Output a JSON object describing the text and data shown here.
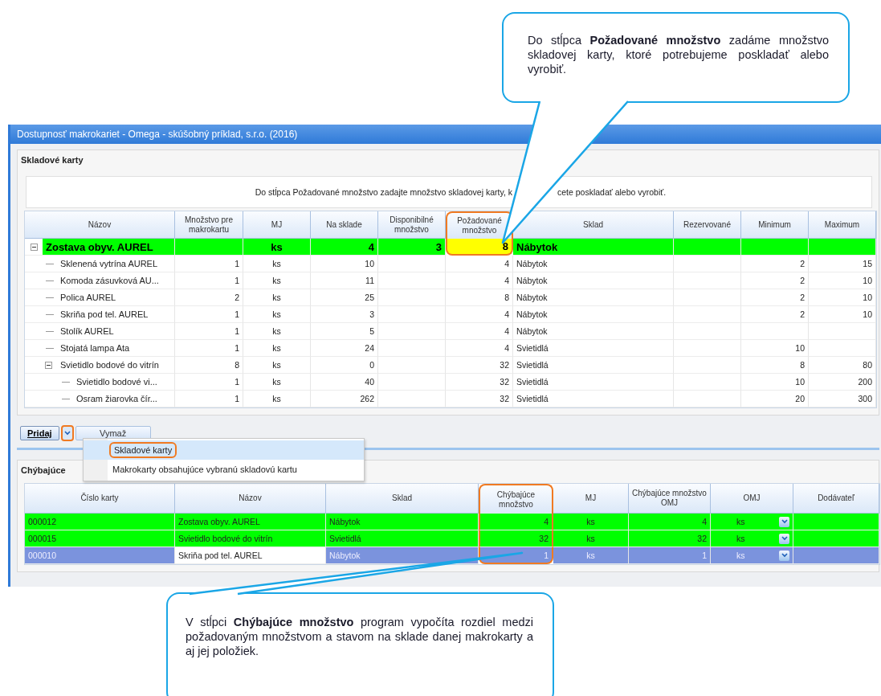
{
  "window": {
    "title": "Dostupnosť makrokariet - Omega - skúšobný príklad, s.r.o. (2016)"
  },
  "stock_panel": {
    "title": "Skladové karty",
    "instruction_parts": [
      "Do stĺpca Požadované množstvo zadajte množstvo skladovej karty, k",
      "cete poskladať alebo vyrobiť."
    ],
    "columns": [
      {
        "label": "Názov",
        "marked": false
      },
      {
        "label": "Množstvo pre makrokartu",
        "marked": false
      },
      {
        "label": "MJ",
        "marked": false
      },
      {
        "label": "Na sklade",
        "marked": false
      },
      {
        "label": "Disponibilné množstvo",
        "marked": false
      },
      {
        "label": "Požadované množstvo",
        "marked": true
      },
      {
        "label": "Sklad",
        "marked": false
      },
      {
        "label": "Rezervované",
        "marked": false
      },
      {
        "label": "Minimum",
        "marked": false
      },
      {
        "label": "Maximum",
        "marked": false
      }
    ],
    "rows": [
      {
        "cells": [
          "Zostava obyv. AUREL",
          null,
          "ks",
          "4",
          "3",
          "8",
          "Nábytok",
          null,
          null,
          null
        ],
        "highlighted": true,
        "focused": true,
        "expanded": true,
        "children": [
          {
            "cells": [
              "Sklenená vytrína AUREL",
              "1",
              "ks",
              "10",
              null,
              "4",
              "Nábytok",
              null,
              "2",
              "15"
            ],
            "highlighted": false
          },
          {
            "cells": [
              "Komoda zásuvková AU...",
              "1",
              "ks",
              "11",
              null,
              "4",
              "Nábytok",
              null,
              "2",
              "10"
            ],
            "highlighted": false
          },
          {
            "cells": [
              "Polica AUREL",
              "2",
              "ks",
              "25",
              null,
              "8",
              "Nábytok",
              null,
              "2",
              "10"
            ],
            "highlighted": false
          },
          {
            "cells": [
              "Skriňa pod tel. AUREL",
              "1",
              "ks",
              "3",
              null,
              "4",
              "Nábytok",
              null,
              "2",
              "10"
            ],
            "highlighted": false
          },
          {
            "cells": [
              "Stolík AUREL",
              "1",
              "ks",
              "5",
              null,
              "4",
              "Nábytok",
              null,
              null,
              null
            ],
            "highlighted": false
          },
          {
            "cells": [
              "Stojatá lampa Ata",
              "1",
              "ks",
              "24",
              null,
              "4",
              "Svietidlá",
              null,
              "10",
              null
            ],
            "highlighted": false
          },
          {
            "cells": [
              "Svietidlo bodové do vitrín",
              "8",
              "ks",
              "0",
              null,
              "32",
              "Svietidlá",
              null,
              "8",
              "80"
            ],
            "highlighted": false,
            "expanded": true,
            "children": [
              {
                "cells": [
                  "Svietidlo bodové vi...",
                  "1",
                  "ks",
                  "40",
                  null,
                  "32",
                  "Svietidlá",
                  null,
                  "10",
                  "200"
                ],
                "highlighted": false
              },
              {
                "cells": [
                  "Osram žiarovka čír...",
                  "1",
                  "ks",
                  "262",
                  null,
                  "32",
                  "Svietidlá",
                  null,
                  "20",
                  "300"
                ],
                "highlighted": false
              }
            ]
          }
        ]
      }
    ]
  },
  "buttons": {
    "add": "Pridaj",
    "delete": "Vymaž"
  },
  "add_menu": {
    "items": [
      {
        "label": "Skladové karty",
        "selected": true
      },
      {
        "label": "Makrokarty obsahujúce vybranú skladovú kartu",
        "selected": false
      }
    ]
  },
  "missing_panel": {
    "title": "Chýbajúce",
    "columns": [
      {
        "label": "Číslo karty",
        "marked": false
      },
      {
        "label": "Názov",
        "marked": false
      },
      {
        "label": "Sklad",
        "marked": false
      },
      {
        "label": "Chýbajúce množstvo",
        "marked": true
      },
      {
        "label": "MJ",
        "marked": false
      },
      {
        "label": "Chýbajúce množstvo OMJ",
        "marked": false
      },
      {
        "label": "OMJ",
        "marked": false
      },
      {
        "label": "Dodávateľ",
        "marked": false
      }
    ],
    "rows": [
      {
        "cells": [
          "000012",
          "Zostava obyv. AUREL",
          "Nábytok",
          "4",
          "ks",
          "4",
          "ks",
          null
        ],
        "highlighted": true,
        "selected": false
      },
      {
        "cells": [
          "000015",
          "Svietidlo bodové do vitrín",
          "Svietidlá",
          "32",
          "ks",
          "32",
          "ks",
          null
        ],
        "highlighted": true,
        "selected": false
      },
      {
        "cells": [
          "000010",
          "Skriňa pod tel. AUREL",
          "Nábytok",
          "1",
          "ks",
          "1",
          "ks",
          null
        ],
        "highlighted": false,
        "selected": true
      }
    ]
  },
  "callouts": [
    {
      "text": "Do stĺpca **Požadované množstvo** zadáme množstvo skladovej karty, ktoré potrebujeme poskladať alebo vyrobiť."
    },
    {
      "text": "V stĺpci **Chýbajúce množstvo** program vypočíta rozdiel medzi požadovaným množstvom a stavom na sklade danej makrokarty a aj jej položiek."
    }
  ]
}
